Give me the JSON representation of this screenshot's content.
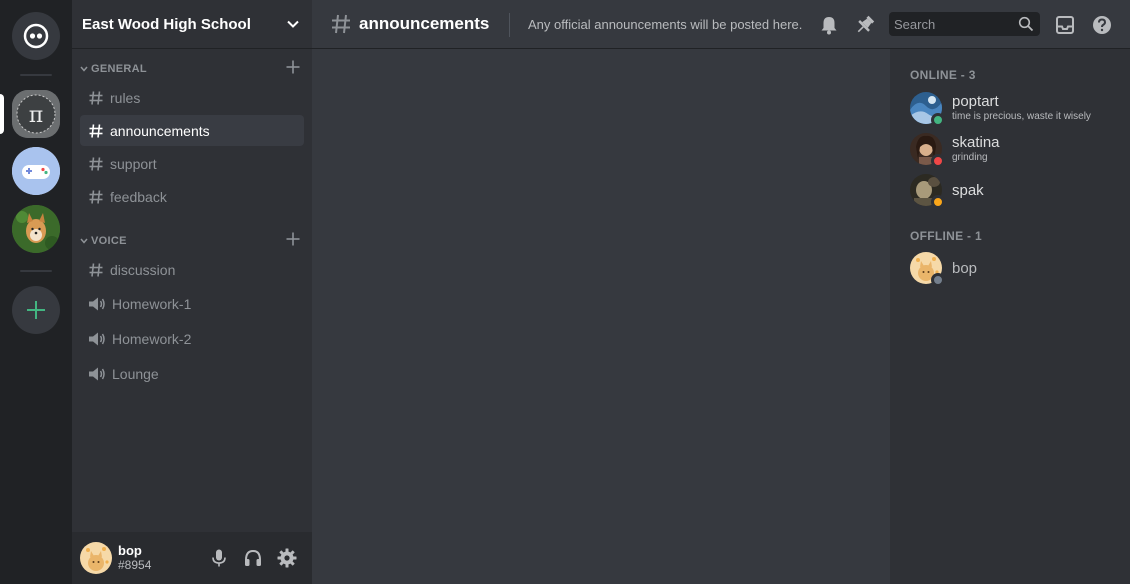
{
  "colors": {
    "online": "#43b581",
    "dnd": "#f04747",
    "idle": "#faa61a",
    "offline": "#747f8d",
    "add_server": "#43b581"
  },
  "servers": [
    {
      "icon": "home-icon"
    },
    {
      "icon": "pi-server-icon",
      "active": true
    },
    {
      "icon": "gamepad-server-icon"
    },
    {
      "icon": "shiba-server-icon"
    },
    {
      "icon": "plus-icon"
    }
  ],
  "guild": {
    "name": "East Wood High School",
    "dropdown_icon": "chevron-down-icon"
  },
  "categories": [
    {
      "label": "GENERAL",
      "channels": [
        {
          "name": "rules",
          "type": "text"
        },
        {
          "name": "announcements",
          "type": "text",
          "active": true
        },
        {
          "name": "support",
          "type": "text"
        },
        {
          "name": "feedback",
          "type": "text"
        }
      ]
    },
    {
      "label": "VOICE",
      "channels": [
        {
          "name": "discussion",
          "type": "text"
        },
        {
          "name": "Homework-1",
          "type": "voice"
        },
        {
          "name": "Homework-2",
          "type": "voice"
        },
        {
          "name": "Lounge",
          "type": "voice"
        }
      ]
    }
  ],
  "user": {
    "name": "bop",
    "tag": "#8954",
    "buttons": [
      "microphone-icon",
      "headphones-icon",
      "gear-icon"
    ]
  },
  "topbar": {
    "channel": "announcements",
    "topic": "Any official announcements will be posted here.",
    "search_placeholder": "Search",
    "icons": [
      "bell-icon",
      "pin-icon",
      "search-icon",
      "inbox-icon",
      "help-icon"
    ]
  },
  "members": {
    "online_header": "ONLINE - 3",
    "offline_header": "OFFLINE - 1",
    "online": [
      {
        "name": "poptart",
        "activity": "time is precious, waste it wisely",
        "status": "online"
      },
      {
        "name": "skatina",
        "activity": "grinding",
        "status": "dnd"
      },
      {
        "name": "spak",
        "activity": "",
        "status": "idle"
      }
    ],
    "offline": [
      {
        "name": "bop",
        "activity": "",
        "status": "offline"
      }
    ]
  }
}
